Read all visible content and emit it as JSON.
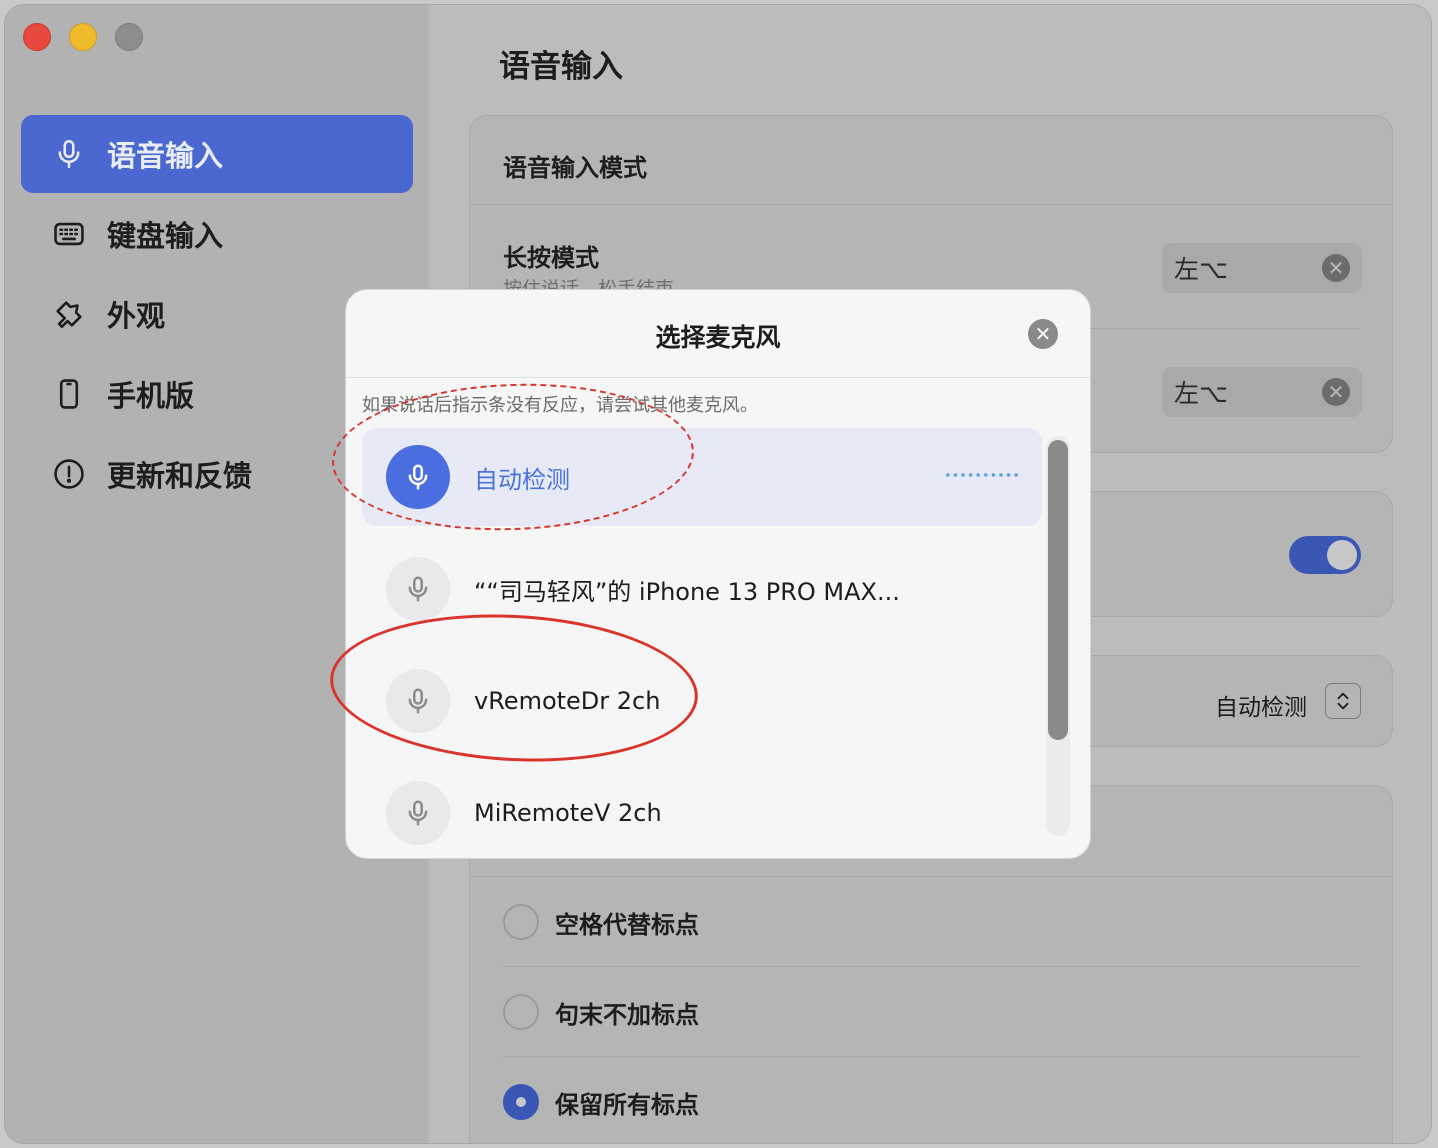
{
  "sidebar": {
    "items": [
      {
        "label": "语音输入",
        "icon": "mic-icon",
        "active": true
      },
      {
        "label": "键盘输入",
        "icon": "keyboard-icon",
        "active": false
      },
      {
        "label": "外观",
        "icon": "paint-icon",
        "active": false
      },
      {
        "label": "手机版",
        "icon": "phone-icon",
        "active": false
      },
      {
        "label": "更新和反馈",
        "icon": "info-icon",
        "active": false
      }
    ]
  },
  "main": {
    "title": "语音输入",
    "mode_card": {
      "heading": "语音输入模式",
      "long_press_title": "长按模式",
      "long_press_sub": "按住说话，松手结束",
      "key1": "左⌥",
      "key2": "左⌥"
    },
    "mic_select_value": "自动检测",
    "punct": [
      {
        "label": "空格代替标点",
        "selected": false
      },
      {
        "label": "句末不加标点",
        "selected": false
      },
      {
        "label": "保留所有标点",
        "selected": true
      }
    ]
  },
  "modal": {
    "title": "选择麦克风",
    "hint": "如果说话后指示条没有反应，请尝试其他麦克风。",
    "mics": [
      {
        "label": "自动检测",
        "selected": true
      },
      {
        "label": "““司马轻风”的 iPhone 13 PRO MAX...",
        "selected": false
      },
      {
        "label": "vRemoteDr 2ch",
        "selected": false
      },
      {
        "label": "MiRemoteV 2ch",
        "selected": false
      }
    ]
  },
  "colors": {
    "accent": "#4a68cf",
    "annotation": "#d9352c"
  }
}
